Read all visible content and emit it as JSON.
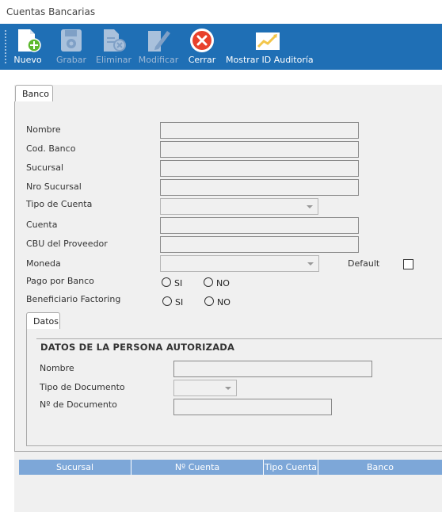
{
  "window": {
    "title": "Cuentas Bancarias"
  },
  "toolbar": {
    "buttons": [
      {
        "label": "Nuevo",
        "icon": "new-document-icon",
        "enabled": true
      },
      {
        "label": "Grabar",
        "icon": "save-disk-icon",
        "enabled": false
      },
      {
        "label": "Eliminar",
        "icon": "delete-document-icon",
        "enabled": false
      },
      {
        "label": "Modificar",
        "icon": "edit-pencil-icon",
        "enabled": false
      },
      {
        "label": "Cerrar",
        "icon": "close-circle-icon",
        "enabled": true
      },
      {
        "label": "Mostrar ID Auditoría",
        "icon": "chart-line-icon",
        "enabled": true
      }
    ]
  },
  "tabs": {
    "banco": "Banco",
    "datos": "Datos"
  },
  "form": {
    "nombre": {
      "label": "Nombre",
      "value": ""
    },
    "cod_banco": {
      "label": "Cod. Banco",
      "value": ""
    },
    "sucursal": {
      "label": "Sucursal",
      "value": ""
    },
    "nro_sucursal": {
      "label": "Nro Sucursal",
      "value": ""
    },
    "tipo_cuenta": {
      "label": "Tipo de Cuenta",
      "value": ""
    },
    "cuenta": {
      "label": "Cuenta",
      "value": ""
    },
    "cbu": {
      "label": "CBU del Proveedor",
      "value": ""
    },
    "moneda": {
      "label": "Moneda",
      "value": ""
    },
    "default": {
      "label": "Default",
      "checked": false
    },
    "pago_por_banco": {
      "label": "Pago por Banco",
      "si": "SI",
      "no": "NO"
    },
    "beneficiario_factoring": {
      "label": "Beneficiario Factoring",
      "si": "SI",
      "no": "NO"
    }
  },
  "datos": {
    "title": "DATOS DE LA PERSONA AUTORIZADA",
    "nombre": {
      "label": "Nombre",
      "value": ""
    },
    "tipo_documento": {
      "label": "Tipo de Documento",
      "value": ""
    },
    "nro_documento": {
      "label": "Nº de Documento",
      "value": ""
    }
  },
  "grid": {
    "columns": [
      "Sucursal",
      "Nº Cuenta",
      "Tipo Cuenta",
      "Banco"
    ]
  },
  "colors": {
    "toolbar": "#1f6fb5",
    "grid_header": "#7da7d8",
    "panel": "#f0f0f0",
    "close_red": "#e8412c"
  }
}
